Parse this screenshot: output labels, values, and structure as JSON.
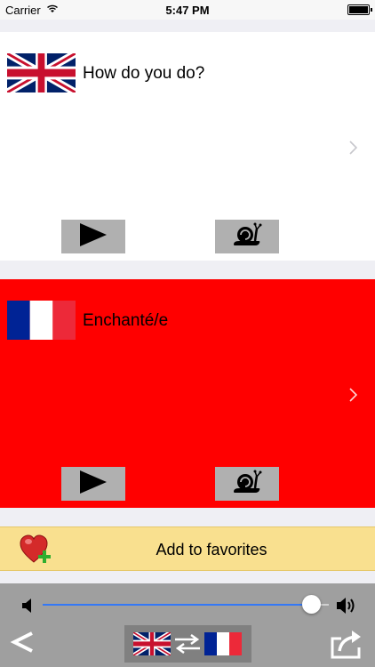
{
  "status_bar": {
    "carrier": "Carrier",
    "time": "5:47 PM"
  },
  "source": {
    "language_flag": "uk-flag-icon",
    "phrase": "How do you do?",
    "background": "#ffffff"
  },
  "target": {
    "language_flag": "france-flag-icon",
    "phrase": "Enchanté/e",
    "background": "#ff0000"
  },
  "favorites": {
    "label": "Add to favorites",
    "background": "#f9e08f"
  },
  "player": {
    "volume_level": 0.96
  },
  "icons": [
    "play-icon",
    "snail-icon",
    "chevron-right-icon",
    "heart-plus-icon",
    "volume-low-icon",
    "volume-high-icon",
    "back-icon",
    "swap-icon",
    "share-icon"
  ]
}
